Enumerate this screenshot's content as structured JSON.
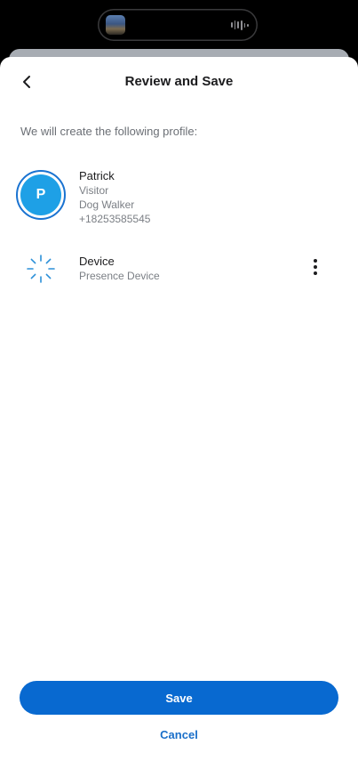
{
  "header": {
    "title": "Review and Save",
    "back_icon": "chevron-left-icon"
  },
  "intro_text": "We will create the following profile:",
  "profile": {
    "initial": "P",
    "name": "Patrick",
    "role": "Visitor",
    "tag": "Dog Walker",
    "phone": "+18253585545",
    "avatar_color": "#1ea0e6",
    "ring_color": "#1a73d1"
  },
  "device": {
    "name": "Device",
    "type": "Presence Device",
    "icon": "presence-device-icon",
    "more_icon": "more-vertical-icon",
    "icon_color": "#2a8fd8"
  },
  "actions": {
    "save_label": "Save",
    "cancel_label": "Cancel",
    "primary_color": "#0869d0"
  }
}
